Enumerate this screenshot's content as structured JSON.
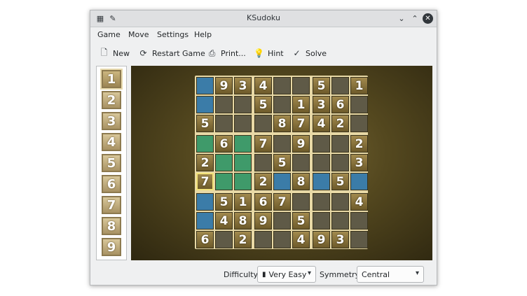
{
  "window": {
    "title": "KSudoku"
  },
  "menu": [
    "Game",
    "Move",
    "Settings",
    "Help"
  ],
  "toolbar": [
    {
      "label": "New",
      "icon": "new-document-icon"
    },
    {
      "label": "Restart Game",
      "icon": "restart-icon"
    },
    {
      "label": "Print...",
      "icon": "print-icon"
    },
    {
      "label": "Hint",
      "icon": "lightbulb-icon"
    },
    {
      "label": "Solve",
      "icon": "check-circle-icon"
    }
  ],
  "number_selector": [
    "1",
    "2",
    "3",
    "4",
    "5",
    "6",
    "7",
    "8",
    "9"
  ],
  "selected_number": "1",
  "board": {
    "values": [
      [
        "",
        "9",
        "3",
        "4",
        "",
        "",
        "5",
        "",
        "1"
      ],
      [
        "",
        "",
        "",
        "5",
        "",
        "1",
        "3",
        "6",
        ""
      ],
      [
        "5",
        "",
        "",
        "",
        "8",
        "7",
        "4",
        "2",
        ""
      ],
      [
        "",
        "6",
        "",
        "7",
        "",
        "9",
        "",
        "",
        "2"
      ],
      [
        "2",
        "",
        "",
        "",
        "5",
        "",
        "",
        "",
        "3"
      ],
      [
        "7",
        "",
        "",
        "2",
        "",
        "8",
        "",
        "5",
        ""
      ],
      [
        "",
        "5",
        "1",
        "6",
        "7",
        "",
        "",
        "",
        "4"
      ],
      [
        "",
        "4",
        "8",
        "9",
        "",
        "5",
        "",
        "",
        ""
      ],
      [
        "6",
        "",
        "2",
        "",
        "",
        "4",
        "9",
        "3",
        ""
      ]
    ],
    "highlight_blue": [
      [
        0,
        0
      ],
      [
        1,
        0
      ],
      [
        5,
        4
      ],
      [
        5,
        6
      ],
      [
        5,
        8
      ],
      [
        6,
        0
      ],
      [
        7,
        0
      ]
    ],
    "highlight_green": [
      [
        3,
        0
      ],
      [
        3,
        1
      ],
      [
        3,
        2
      ],
      [
        4,
        0
      ],
      [
        4,
        1
      ],
      [
        4,
        2
      ],
      [
        5,
        1
      ],
      [
        5,
        2
      ]
    ],
    "selected_cell": [
      5,
      0
    ]
  },
  "status": {
    "difficulty_label": "Difficulty",
    "difficulty_value": "Very Easy",
    "symmetry_label": "Symmetry",
    "symmetry_value": "Central"
  },
  "colors": {
    "blue_highlight": "#3b7ca8",
    "green_highlight": "#3f9a6a",
    "tile_gold": "#a28a4e"
  }
}
